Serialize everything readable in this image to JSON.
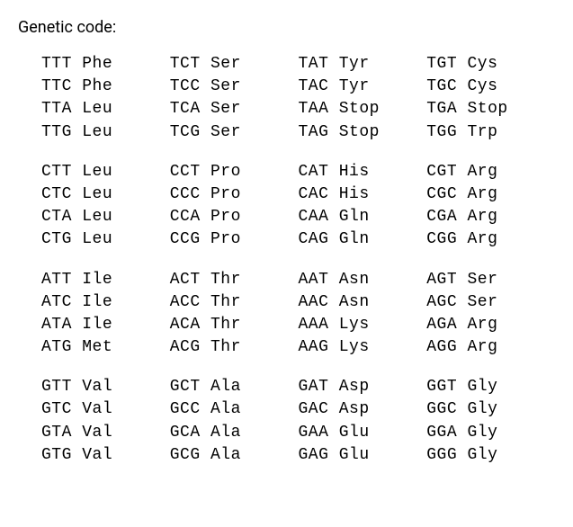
{
  "title": "Genetic code:",
  "blocks": [
    {
      "rows": [
        [
          {
            "codon": "TTT",
            "aa": "Phe"
          },
          {
            "codon": "TCT",
            "aa": "Ser"
          },
          {
            "codon": "TAT",
            "aa": "Tyr"
          },
          {
            "codon": "TGT",
            "aa": "Cys"
          }
        ],
        [
          {
            "codon": "TTC",
            "aa": "Phe"
          },
          {
            "codon": "TCC",
            "aa": "Ser"
          },
          {
            "codon": "TAC",
            "aa": "Tyr"
          },
          {
            "codon": "TGC",
            "aa": "Cys"
          }
        ],
        [
          {
            "codon": "TTA",
            "aa": "Leu"
          },
          {
            "codon": "TCA",
            "aa": "Ser"
          },
          {
            "codon": "TAA",
            "aa": "Stop"
          },
          {
            "codon": "TGA",
            "aa": "Stop"
          }
        ],
        [
          {
            "codon": "TTG",
            "aa": "Leu"
          },
          {
            "codon": "TCG",
            "aa": "Ser"
          },
          {
            "codon": "TAG",
            "aa": "Stop"
          },
          {
            "codon": "TGG",
            "aa": "Trp"
          }
        ]
      ]
    },
    {
      "rows": [
        [
          {
            "codon": "CTT",
            "aa": "Leu"
          },
          {
            "codon": "CCT",
            "aa": "Pro"
          },
          {
            "codon": "CAT",
            "aa": "His"
          },
          {
            "codon": "CGT",
            "aa": "Arg"
          }
        ],
        [
          {
            "codon": "CTC",
            "aa": "Leu"
          },
          {
            "codon": "CCC",
            "aa": "Pro"
          },
          {
            "codon": "CAC",
            "aa": "His"
          },
          {
            "codon": "CGC",
            "aa": "Arg"
          }
        ],
        [
          {
            "codon": "CTA",
            "aa": "Leu"
          },
          {
            "codon": "CCA",
            "aa": "Pro"
          },
          {
            "codon": "CAA",
            "aa": "Gln"
          },
          {
            "codon": "CGA",
            "aa": "Arg"
          }
        ],
        [
          {
            "codon": "CTG",
            "aa": "Leu"
          },
          {
            "codon": "CCG",
            "aa": "Pro"
          },
          {
            "codon": "CAG",
            "aa": "Gln"
          },
          {
            "codon": "CGG",
            "aa": "Arg"
          }
        ]
      ]
    },
    {
      "rows": [
        [
          {
            "codon": "ATT",
            "aa": "Ile"
          },
          {
            "codon": "ACT",
            "aa": "Thr"
          },
          {
            "codon": "AAT",
            "aa": "Asn"
          },
          {
            "codon": "AGT",
            "aa": "Ser"
          }
        ],
        [
          {
            "codon": "ATC",
            "aa": "Ile"
          },
          {
            "codon": "ACC",
            "aa": "Thr"
          },
          {
            "codon": "AAC",
            "aa": "Asn"
          },
          {
            "codon": "AGC",
            "aa": "Ser"
          }
        ],
        [
          {
            "codon": "ATA",
            "aa": "Ile"
          },
          {
            "codon": "ACA",
            "aa": "Thr"
          },
          {
            "codon": "AAA",
            "aa": "Lys"
          },
          {
            "codon": "AGA",
            "aa": "Arg"
          }
        ],
        [
          {
            "codon": "ATG",
            "aa": "Met"
          },
          {
            "codon": "ACG",
            "aa": "Thr"
          },
          {
            "codon": "AAG",
            "aa": "Lys"
          },
          {
            "codon": "AGG",
            "aa": "Arg"
          }
        ]
      ]
    },
    {
      "rows": [
        [
          {
            "codon": "GTT",
            "aa": "Val"
          },
          {
            "codon": "GCT",
            "aa": "Ala"
          },
          {
            "codon": "GAT",
            "aa": "Asp"
          },
          {
            "codon": "GGT",
            "aa": "Gly"
          }
        ],
        [
          {
            "codon": "GTC",
            "aa": "Val"
          },
          {
            "codon": "GCC",
            "aa": "Ala"
          },
          {
            "codon": "GAC",
            "aa": "Asp"
          },
          {
            "codon": "GGC",
            "aa": "Gly"
          }
        ],
        [
          {
            "codon": "GTA",
            "aa": "Val"
          },
          {
            "codon": "GCA",
            "aa": "Ala"
          },
          {
            "codon": "GAA",
            "aa": "Glu"
          },
          {
            "codon": "GGA",
            "aa": "Gly"
          }
        ],
        [
          {
            "codon": "GTG",
            "aa": "Val"
          },
          {
            "codon": "GCG",
            "aa": "Ala"
          },
          {
            "codon": "GAG",
            "aa": "Glu"
          },
          {
            "codon": "GGG",
            "aa": "Gly"
          }
        ]
      ]
    }
  ]
}
